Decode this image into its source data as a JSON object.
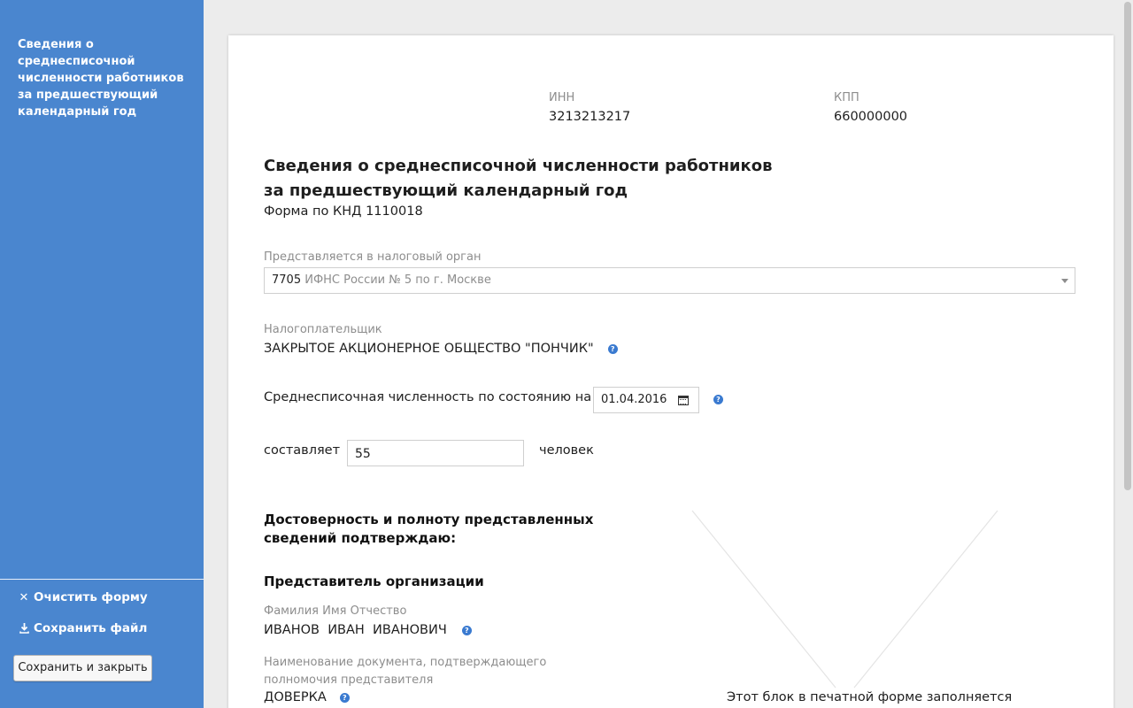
{
  "sidebar": {
    "title": "Сведения о среднесписочной численности работников за предшествующий календарный год",
    "actions": {
      "clear_label": "Очистить форму",
      "save_file_label": "Сохранить файл"
    },
    "save_close_label": "Сохранить и закрыть"
  },
  "header": {
    "inn_label": "ИНН",
    "inn_value": "3213213217",
    "kpp_label": "КПП",
    "kpp_value": "660000000"
  },
  "form": {
    "title_line1": "Сведения о среднесписочной численности работников",
    "title_line2": "за предшествующий календарный год",
    "code": "Форма по КНД 1110018",
    "tax_authority": {
      "label": "Представляется в налоговый орган",
      "code": "7705",
      "name": "ИФНС России № 5 по г. Москве"
    },
    "taxpayer": {
      "label": "Налогоплательщик",
      "value": "ЗАКРЫТОЕ АКЦИОНЕРНОЕ ОБЩЕСТВО \"ПОНЧИК\""
    },
    "headcount": {
      "label": "Среднесписочная численность по состоянию на",
      "date": "01.04.2016",
      "amount_prefix": "составляет",
      "amount": "55",
      "amount_suffix": "человек"
    },
    "confirm": {
      "heading": "Достоверность и полноту представленных сведений подтверждаю:",
      "representative_heading": "Представитель организации",
      "fio_label": "Фамилия Имя Отчество",
      "fio_value": "ИВАНОВ  ИВАН  ИВАНОВИЧ",
      "doc_label": "Наименование документа, подтверждающего полномочия представителя",
      "doc_value": "ДОВЕРКА"
    },
    "print_note": "Этот блок в печатной форме заполняется"
  },
  "colors": {
    "sidebar_bg": "#4a86cf",
    "help_icon": "#3a7ad0"
  },
  "icons": {
    "clear": "close-icon",
    "save_file": "download-icon",
    "help": "help-icon",
    "calendar": "calendar-icon",
    "dropdown": "chevron-down-icon"
  }
}
